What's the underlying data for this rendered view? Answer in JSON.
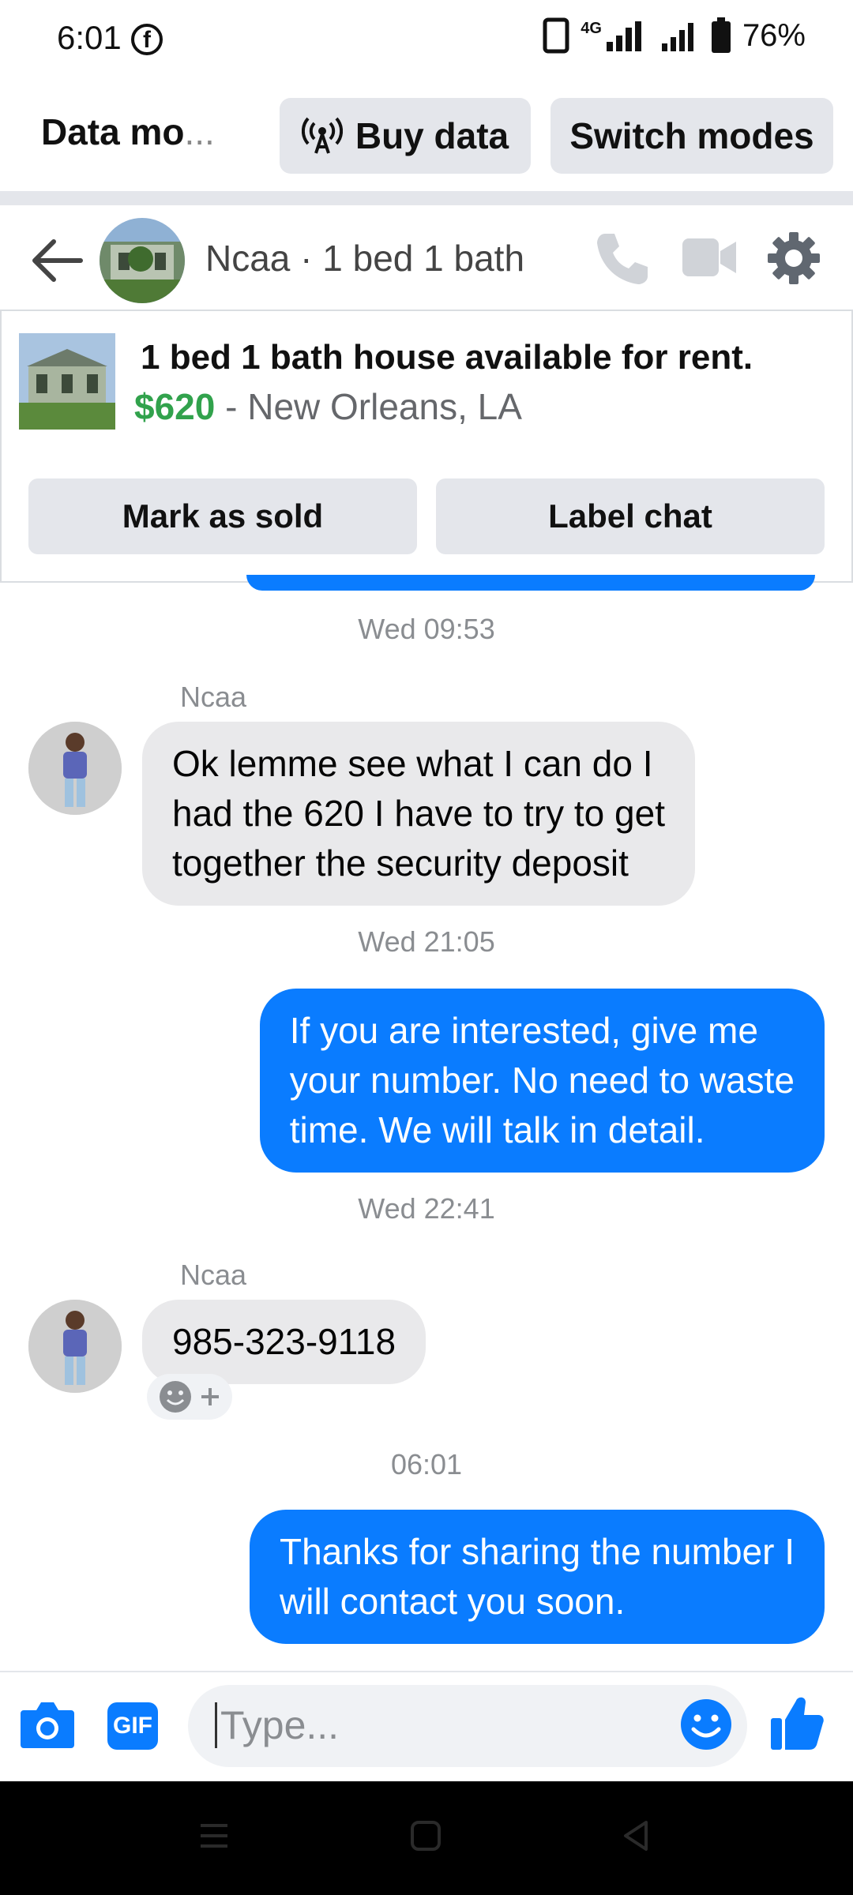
{
  "status_bar": {
    "time": "6:01",
    "network": "4G",
    "battery": "76%"
  },
  "data_bar": {
    "mode_label": "Data mo",
    "mode_ellipsis": "...",
    "buy_data": "Buy data",
    "switch_modes": "Switch modes"
  },
  "header": {
    "title": "Ncaa · 1 bed 1 bath"
  },
  "listing": {
    "title": "1 bed 1 bath house available for rent.",
    "price": "$620",
    "location": "- New Orleans, LA",
    "mark_as_sold": "Mark as sold",
    "label_chat": "Label chat"
  },
  "messages": [
    {
      "type": "timestamp",
      "text": "Wed 09:53"
    },
    {
      "type": "incoming",
      "sender": "Ncaa",
      "lines": [
        "Ok lemme see what I can do I",
        "had the 620 I have to try to get",
        "together the security deposit"
      ]
    },
    {
      "type": "timestamp",
      "text": "Wed 21:05"
    },
    {
      "type": "outgoing",
      "lines": [
        "If you are interested, give me",
        "your number. No need to waste",
        "time. We will talk in detail."
      ]
    },
    {
      "type": "timestamp",
      "text": "Wed 22:41"
    },
    {
      "type": "incoming",
      "sender": "Ncaa",
      "lines": [
        "985-323-9118"
      ]
    },
    {
      "type": "timestamp",
      "text": "06:01"
    },
    {
      "type": "outgoing",
      "lines": [
        "Thanks for sharing the number I",
        "will contact you soon."
      ]
    }
  ],
  "composer": {
    "placeholder": "Type...",
    "gif_label": "GIF"
  },
  "colors": {
    "accent": "#0a7cff",
    "price": "#31a24c",
    "bubble_in": "#e9e9eb",
    "pill": "#e4e6eb"
  },
  "icons": [
    "facebook-icon",
    "phone-icon",
    "video-icon",
    "gear-icon",
    "back-arrow-icon",
    "camera-icon",
    "emoji-icon",
    "thumbs-up-icon",
    "broadcast-icon",
    "nav-menu-icon",
    "nav-home-icon",
    "nav-back-icon"
  ]
}
